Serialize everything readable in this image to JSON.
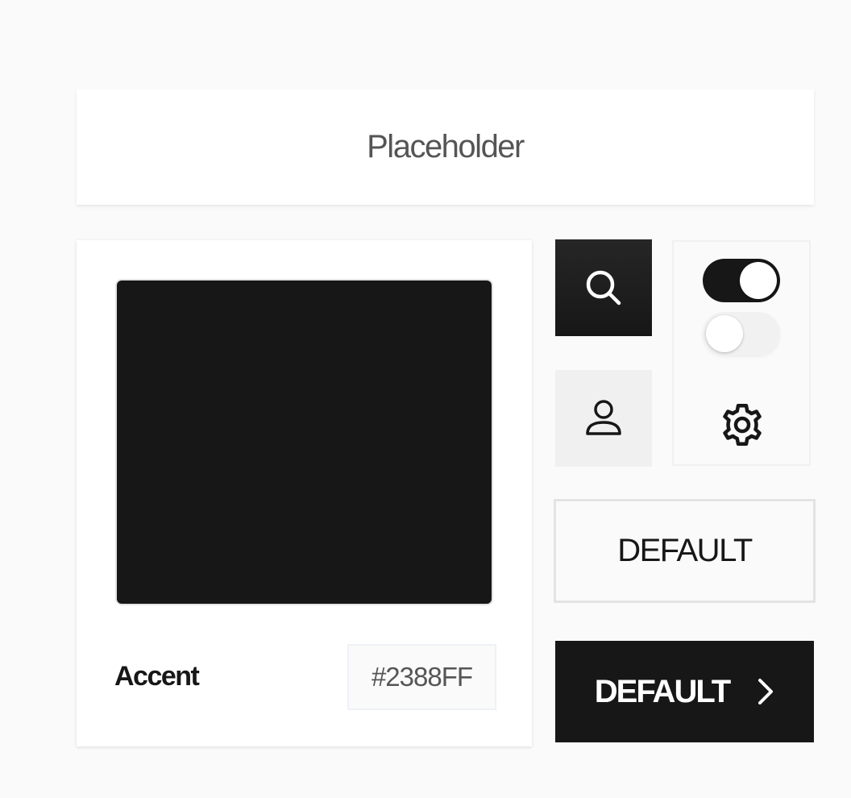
{
  "search": {
    "placeholder": "Placeholder"
  },
  "color_picker": {
    "swatch_color": "#171717",
    "label": "Accent",
    "hex_value": "#2388FF"
  },
  "icons": {
    "search": "search-icon",
    "user": "user-icon",
    "settings": "gear-icon",
    "chevron": "chevron-right-icon"
  },
  "toggles": [
    {
      "state": "on"
    },
    {
      "state": "off"
    }
  ],
  "buttons": {
    "outline_label": "DEFAULT",
    "primary_label": "DEFAULT"
  },
  "colors": {
    "background": "#fafafa",
    "surface": "#ffffff",
    "dark": "#171717",
    "muted_tile": "#f0f0f0",
    "border": "#e3e3e3",
    "text_muted": "#555555"
  }
}
